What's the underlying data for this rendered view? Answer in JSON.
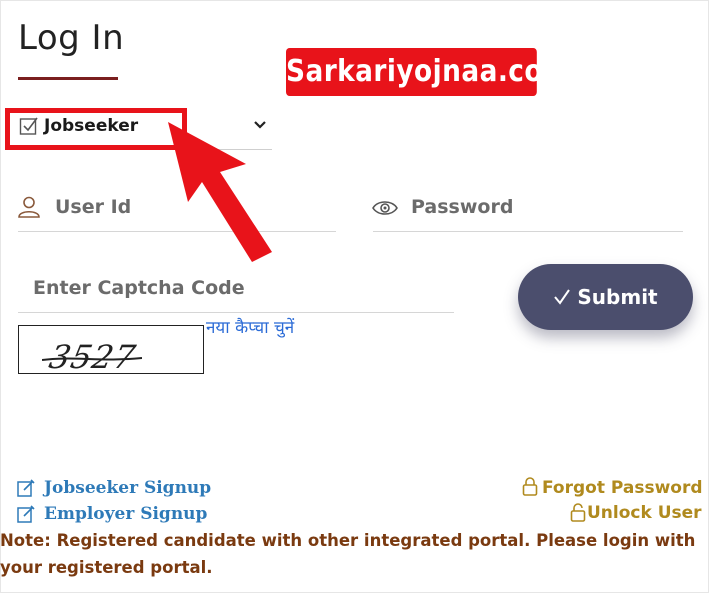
{
  "header": {
    "title": "Log In"
  },
  "watermark": "Sarkariyojnaa.com",
  "user_type_select": {
    "selected": "Jobseeker"
  },
  "fields": {
    "user_id": {
      "placeholder": "User Id"
    },
    "password": {
      "placeholder": "Password"
    },
    "captcha": {
      "placeholder": "Enter Captcha Code"
    }
  },
  "submit_label": "Submit",
  "captcha": {
    "refresh_label": "नया कैप्चा चुनें",
    "image_text": "3527"
  },
  "links": {
    "jobseeker_signup": "Jobseeker  Signup",
    "employer_signup": "Employer  Signup",
    "forgot_password": "Forgot Password",
    "unlock_user": "Unlock User"
  },
  "note": "Note: Registered candidate with other integrated portal. Please login with your registered portal.",
  "colors": {
    "accent_red": "#e8131a",
    "submit_bg": "#4b4e6d",
    "link_blue": "#2e7ab8",
    "link_gold": "#b08a1e",
    "note_brown": "#7a3a10"
  }
}
